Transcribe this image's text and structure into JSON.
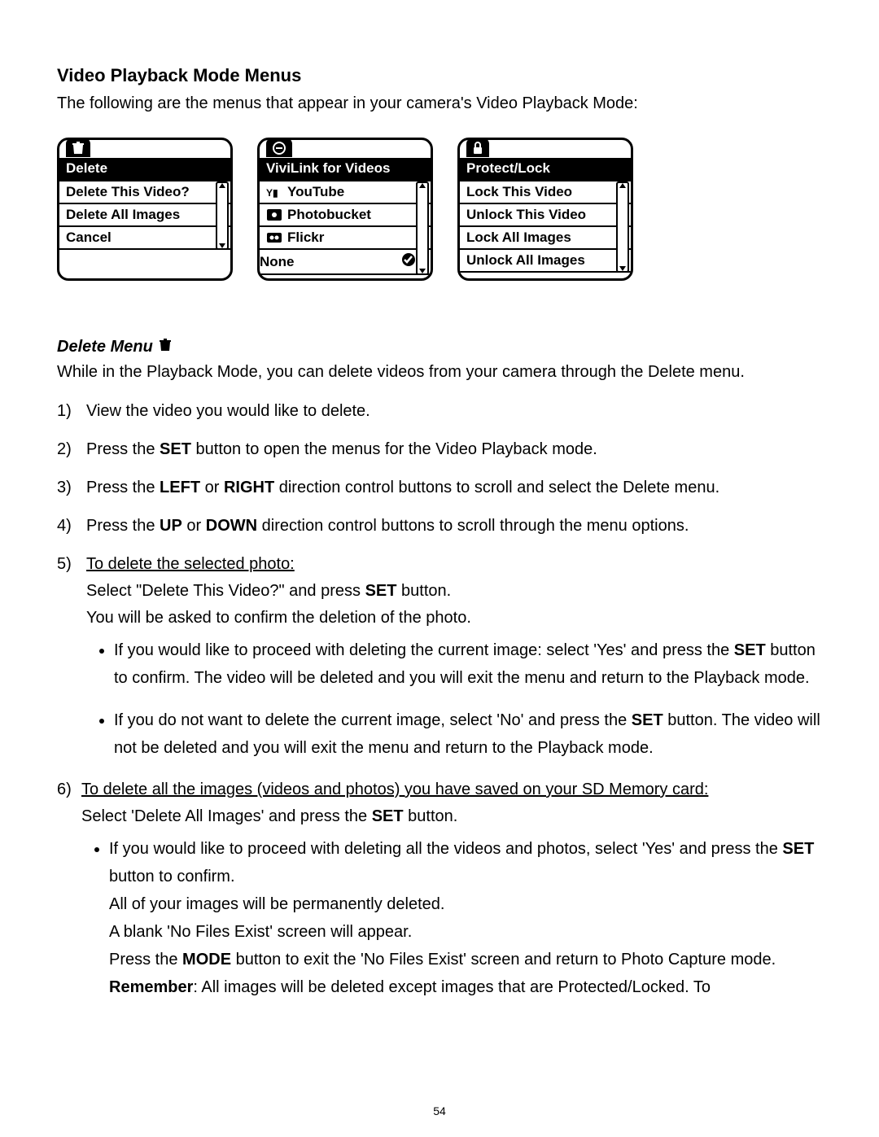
{
  "section_title": "Video Playback Mode Menus",
  "intro": "The following are the menus that appear in your camera's Video Playback Mode:",
  "menus": {
    "delete": {
      "title": "Delete",
      "items": [
        "Delete This Video?",
        "Delete All Images",
        "Cancel"
      ]
    },
    "vivilink": {
      "title": "ViviLink for Videos",
      "items": [
        {
          "icon": "youtube",
          "label": "YouTube"
        },
        {
          "icon": "photobucket",
          "label": "Photobucket"
        },
        {
          "icon": "flickr",
          "label": "Flickr"
        },
        {
          "icon": null,
          "label": "None",
          "checked": true
        }
      ]
    },
    "protect": {
      "title": "Protect/Lock",
      "items": [
        "Lock This Video",
        "Unlock This Video",
        "Lock All Images",
        "Unlock All Images"
      ]
    }
  },
  "sub_title": "Delete Menu",
  "sub_intro": "While in the Playback Mode, you can delete videos from your camera through the Delete menu.",
  "steps": {
    "s1": "View the video you would like to delete.",
    "s2_a": "Press the ",
    "s2_set": "SET",
    "s2_b": " button to open the menus for the Video Playback mode.",
    "s3_a": "Press the ",
    "s3_left": "LEFT",
    "s3_or": " or ",
    "s3_right": "RIGHT",
    "s3_b": " direction control buttons to scroll and select the Delete menu.",
    "s4_a": "Press the ",
    "s4_up": "UP",
    "s4_or": " or ",
    "s4_down": "DOWN",
    "s4_b": " direction control buttons to scroll through the menu options.",
    "s5_head": "To delete the selected photo:",
    "s5_l1_a": "Select \"Delete This Video?\" and press ",
    "s5_l1_set": "SET",
    "s5_l1_b": " button.",
    "s5_l2": "You will be asked to confirm the deletion of the photo.",
    "s5_b1_a": "If you would like to proceed with deleting the current image: select 'Yes' and press the ",
    "s5_b1_set": "SET",
    "s5_b1_b": " button to confirm. The video will be deleted and you will exit the menu and return to the Playback mode.",
    "s5_b2_a": "If you do not want to delete the current image, select 'No' and press the ",
    "s5_b2_set": "SET",
    "s5_b2_b": " button. The video will not be deleted and you will exit the menu and return to the Playback mode.",
    "s6_head": "To delete all the images (videos and photos) you have saved on your SD Memory card:",
    "s6_l1_a": "Select 'Delete All Images' and press the ",
    "s6_l1_set": "SET",
    "s6_l1_b": " button.",
    "s6_b1_a": "If you would like to proceed with deleting all the videos and photos, select 'Yes' and press the ",
    "s6_b1_set": "SET",
    "s6_b1_b": " button to confirm.",
    "s6_b1_c": "All of your images will be permanently deleted.",
    "s6_b1_d": "A blank 'No Files Exist' screen will appear.",
    "s6_b1_e_a": "Press the ",
    "s6_b1_e_mode": "MODE",
    "s6_b1_e_b": " button to exit the 'No Files Exist' screen and return to Photo Capture mode.",
    "s6_b1_f_rem": "Remember",
    "s6_b1_f_txt": ": All images will be deleted except images that are Protected/Locked. To"
  },
  "page_number": "54"
}
